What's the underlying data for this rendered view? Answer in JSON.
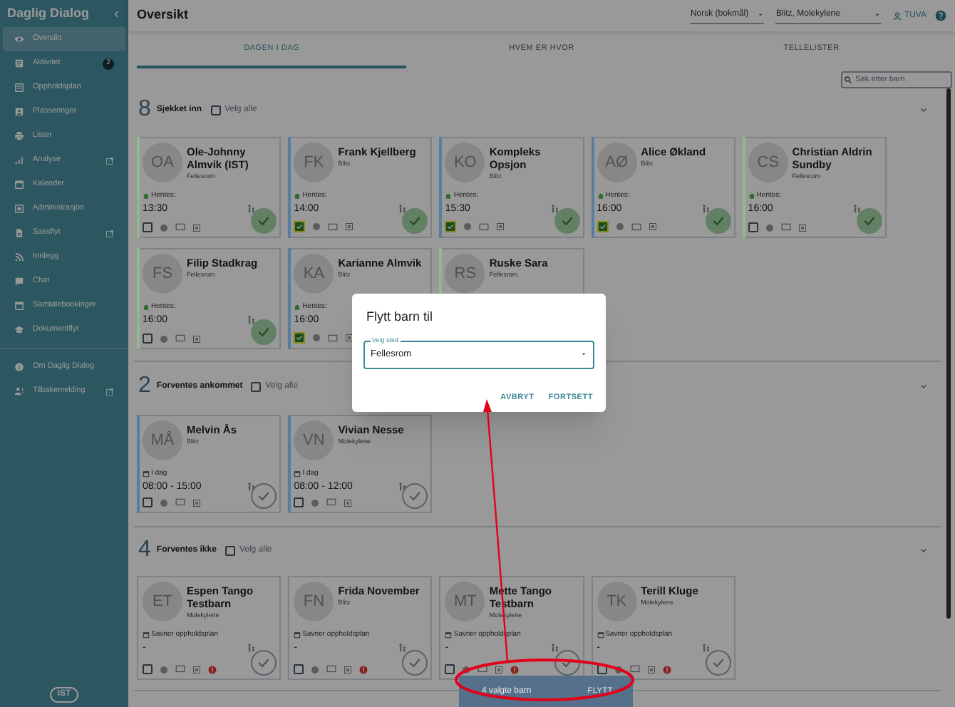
{
  "sidebar": {
    "title": "Daglig Dialog",
    "items": [
      {
        "label": "Oversikt",
        "selected": true,
        "external": false
      },
      {
        "label": "Aktivitet",
        "badge": "2",
        "selected": false,
        "external": false
      },
      {
        "label": "Oppholdsplan",
        "selected": false,
        "external": false
      },
      {
        "label": "Plasseringer",
        "selected": false,
        "external": false
      },
      {
        "label": "Lister",
        "selected": false,
        "external": false
      },
      {
        "label": "Analyse",
        "selected": false,
        "external": true
      },
      {
        "label": "Kalender",
        "selected": false,
        "external": false
      },
      {
        "label": "Administrasjon",
        "selected": false,
        "external": false
      },
      {
        "label": "Saksflyt",
        "selected": false,
        "external": true
      },
      {
        "label": "Innlegg",
        "selected": false,
        "external": false
      },
      {
        "label": "Chat",
        "selected": false,
        "external": false
      },
      {
        "label": "Samtalebookinger",
        "selected": false,
        "external": false
      },
      {
        "label": "Dokumentflyt",
        "selected": false,
        "external": false
      }
    ],
    "footer_items": [
      {
        "label": "Om Daglig Dialog",
        "selected": false,
        "external": false
      },
      {
        "label": "Tilbakemelding",
        "selected": false,
        "external": true
      }
    ],
    "logo": "IST"
  },
  "header": {
    "title": "Oversikt",
    "language": "Norsk (bokmål)",
    "department": "Blitz, Molekylene",
    "user": "TUVA"
  },
  "tabs": [
    {
      "label": "DAGEN I DAG",
      "selected": true
    },
    {
      "label": "HVEM ER HVOR",
      "selected": false
    },
    {
      "label": "TELLELISTER",
      "selected": false
    }
  ],
  "search": {
    "placeholder": "Søk etter barn"
  },
  "sections": [
    {
      "count": "8",
      "title": "Sjekket inn",
      "select_all": "Velg alle",
      "select_all_checked": false,
      "cards": [
        {
          "initials": "OA",
          "name": "Ole-Johnny Almvik (IST)",
          "group": "Fellesrom",
          "color": "#8fb98f",
          "kind": "pickup",
          "info_label": "Hentes:",
          "time": "13:30",
          "selected": false,
          "alert": false,
          "check_button": {
            "kind": "done"
          }
        },
        {
          "initials": "FK",
          "name": "Frank Kjellberg",
          "group": "Blitz",
          "color": "#587e9f",
          "kind": "pickup",
          "info_label": "Hentes:",
          "time": "14:00",
          "selected": true,
          "alert": false,
          "check_button": {
            "kind": "done"
          }
        },
        {
          "initials": "KO",
          "name": "Kompleks Opsjon",
          "group": "Blitz",
          "color": "#587e9f",
          "kind": "pickup",
          "info_label": "Hentes:",
          "time": "15:30",
          "selected": true,
          "alert": false,
          "check_button": {
            "kind": "done"
          }
        },
        {
          "initials": "AØ",
          "name": "Alice Økland",
          "group": "Blitz",
          "color": "#587e9f",
          "kind": "pickup",
          "info_label": "Hentes:",
          "time": "16:00",
          "selected": true,
          "alert": false,
          "check_button": {
            "kind": "done"
          }
        },
        {
          "initials": "CS",
          "name": "Christian Aldrin Sundby",
          "group": "Fellesrom",
          "color": "#8fb98f",
          "kind": "pickup",
          "info_label": "Hentes:",
          "time": "16:00",
          "selected": false,
          "alert": false,
          "check_button": {
            "kind": "done"
          }
        },
        {
          "initials": "FS",
          "name": "Filip Stadkrag",
          "group": "Fellesrom",
          "color": "#8fb98f",
          "kind": "pickup",
          "info_label": "Hentes:",
          "time": "16:00",
          "selected": false,
          "alert": false,
          "check_button": {
            "kind": "done"
          }
        },
        {
          "initials": "KA",
          "name": "Karianne Almvik",
          "group": "Blitz",
          "color": "#587e9f",
          "kind": "pickup",
          "info_label": "Hentes:",
          "time": "16:00",
          "selected": true,
          "alert": false
        },
        {
          "initials": "RS",
          "name": "Ruske Sara",
          "group": "Fellesrom",
          "color": "#8fb98f"
        }
      ]
    },
    {
      "count": "2",
      "title": "Forventes ankommet",
      "select_all": "Velg alle",
      "select_all_checked": false,
      "cards": [
        {
          "initials": "MÅ",
          "name": "Melvin Ås",
          "group": "Blitz",
          "color": "#587e9f",
          "kind": "plan",
          "info_label": "I dag",
          "time": "08:00 - 15:00",
          "selected": false,
          "alert": false,
          "check_button": {
            "kind": "pending"
          }
        },
        {
          "initials": "VN",
          "name": "Vivian Nesse",
          "group": "Molekylene",
          "color": "#587e9f",
          "kind": "plan",
          "info_label": "I dag",
          "time": "08:00 - 12:00",
          "selected": false,
          "alert": false,
          "check_button": {
            "kind": "pending"
          }
        }
      ]
    },
    {
      "count": "4",
      "title": "Forventes ikke",
      "select_all": "Velg alle",
      "select_all_checked": false,
      "cards": [
        {
          "initials": "ET",
          "name": "Espen Tango Testbarn",
          "group": "Molekylene",
          "kind": "plan",
          "info_label": "Savner oppholdsplan",
          "time": "-",
          "selected": false,
          "alert": true,
          "check_button": {
            "kind": "pending"
          }
        },
        {
          "initials": "FN",
          "name": "Frida November",
          "group": "Blitz",
          "kind": "plan",
          "info_label": "Savner oppholdsplan",
          "time": "-",
          "selected": false,
          "alert": true,
          "check_button": {
            "kind": "pending"
          }
        },
        {
          "initials": "MT",
          "name": "Mette Tango Testbarn",
          "group": "Molekylene",
          "kind": "plan",
          "info_label": "Savner oppholdsplan",
          "time": "-",
          "selected": false,
          "alert": true,
          "check_button": {
            "kind": "pending"
          }
        },
        {
          "initials": "TK",
          "name": "Terill Kluge",
          "group": "Molekylene",
          "kind": "plan",
          "info_label": "Savner oppholdsplan",
          "time": "-",
          "selected": false,
          "alert": true,
          "check_button": {
            "kind": "pending"
          }
        }
      ]
    }
  ],
  "dialog": {
    "title": "Flytt barn til",
    "field_label": "Velg sted",
    "field_value": "Fellesrom",
    "buttons": [
      "AVBRYT",
      "FORTSETT"
    ]
  },
  "snackbar": {
    "text": "4 valgte barn",
    "action": "FLYTT"
  }
}
